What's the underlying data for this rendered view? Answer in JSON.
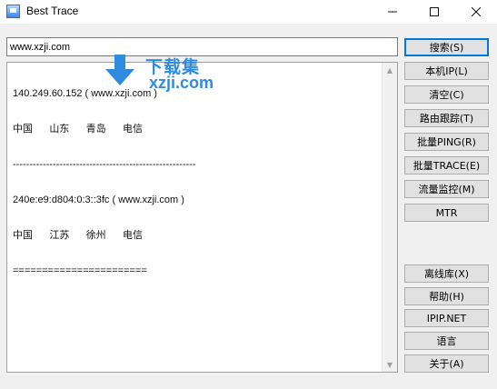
{
  "window": {
    "title": "Best Trace"
  },
  "search": {
    "value": "www.xzji.com"
  },
  "output": {
    "lines": [
      "140.249.60.152 ( www.xzji.com )",
      "中国      山东      青岛      电信",
      "-------------------------------------------------------",
      "240e:e9:d804:0:3::3fc ( www.xzji.com )",
      "中国      江苏      徐州      电信",
      "======================="
    ]
  },
  "watermark": {
    "text": "下载集",
    "url": "xzji.com"
  },
  "buttons": {
    "search": "搜索(S)",
    "local_ip": "本机IP(L)",
    "clear": "清空(C)",
    "route_trace": "路由跟踪(T)",
    "batch_ping": "批量PING(R)",
    "batch_trace": "批量TRACE(E)",
    "traffic_monitor": "流量监控(M)",
    "mtr": "MTR",
    "offline_db": "离线库(X)",
    "help": "帮助(H)",
    "ipip": "IPIP.NET",
    "language": "语言",
    "about": "关于(A)"
  }
}
